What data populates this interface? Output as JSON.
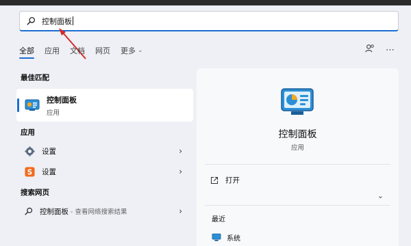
{
  "search": {
    "value": "控制面板"
  },
  "tabs": [
    {
      "label": "全部"
    },
    {
      "label": "应用"
    },
    {
      "label": "文档"
    },
    {
      "label": "网页"
    },
    {
      "label": "更多"
    }
  ],
  "sections": {
    "best_match": "最佳匹配",
    "apps": "应用",
    "web": "搜索网页"
  },
  "best_match": {
    "title": "控制面板",
    "subtitle": "应用"
  },
  "apps": [
    {
      "label": "设置"
    },
    {
      "label": "设置"
    }
  ],
  "web_result": {
    "label": "控制面板",
    "suffix": " - 查看网络搜索结果"
  },
  "detail": {
    "title": "控制面板",
    "subtitle": "应用",
    "open_label": "打开",
    "recent_title": "最近",
    "recent_items": [
      {
        "label": "系统"
      }
    ]
  },
  "colors": {
    "accent": "#1a6dd3",
    "arrow": "#d42a2a"
  },
  "icons": {
    "search": "search-icon",
    "more": "more-icon",
    "account": "account-icon",
    "open": "open-external-icon"
  }
}
